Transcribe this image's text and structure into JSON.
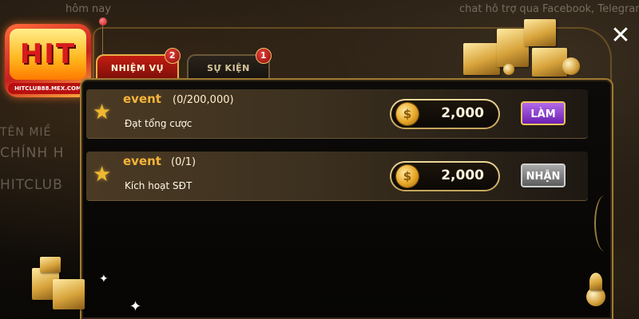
{
  "background": {
    "top_left_text": "hôm nay",
    "top_right_text": "chat hỗ trợ qua Facebook, Telegram",
    "left_line_1": "TÊN MIỀ",
    "left_line_2": "CHÍNH H",
    "left_line_3": "HITCLUB"
  },
  "logo": {
    "word": "HIT",
    "url": "HITCLUB88.MEX.COM"
  },
  "tabs": [
    {
      "label": "NHIỆM VỤ",
      "badge": "2",
      "active": true
    },
    {
      "label": "SỰ KIỆN",
      "badge": "1",
      "active": false
    }
  ],
  "tasks": [
    {
      "name": "event",
      "progress": "(0/200,000)",
      "description": "Đạt tổng cược",
      "reward": "2,000",
      "action": "LÀM"
    },
    {
      "name": "event",
      "progress": "(0/1)",
      "description": "Kích hoạt SĐT",
      "reward": "2,000",
      "action": "NHẬN"
    }
  ],
  "icons": {
    "star": "star-icon",
    "coin": "coin-icon",
    "close": "close-icon"
  },
  "colors": {
    "accent_gold": "#e6b24a",
    "tab_active": "#c21d12",
    "button_do": "#8a3fd0",
    "button_claim": "#7a7a7a"
  }
}
